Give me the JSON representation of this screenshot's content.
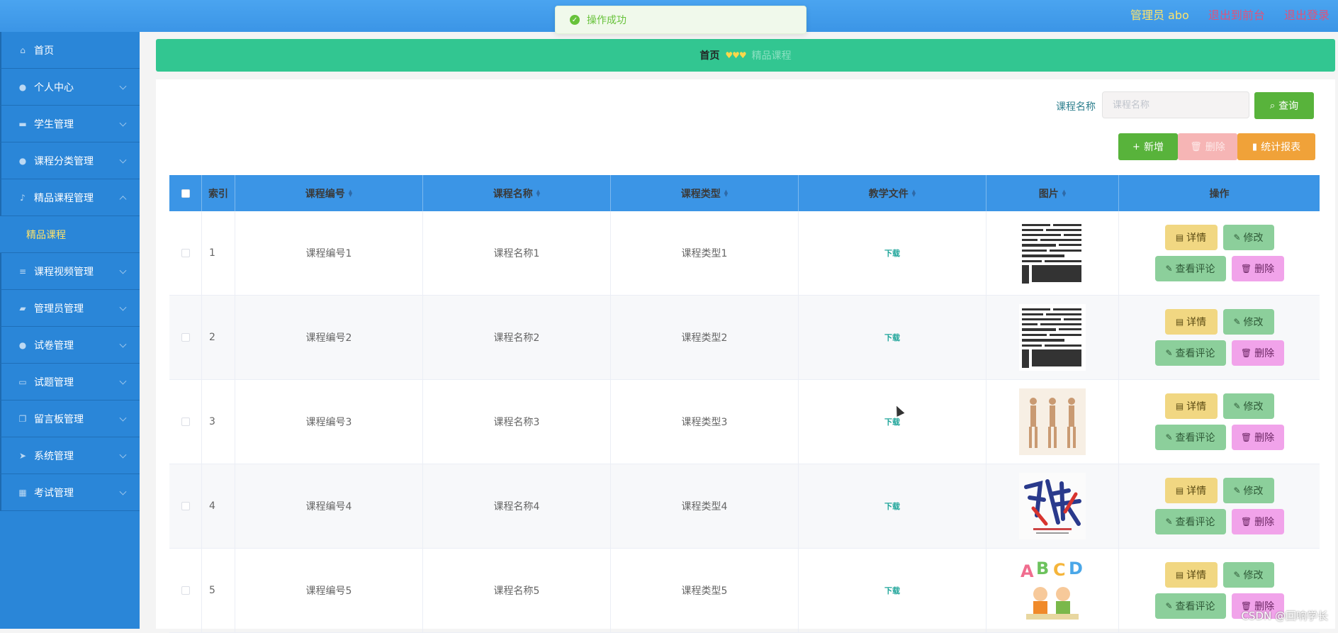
{
  "header": {
    "admin_label": "管理员 abo",
    "back_link": "退出到前台",
    "logout_link": "退出登录"
  },
  "toast": {
    "message": "操作成功"
  },
  "sidebar": {
    "items": [
      {
        "label": "首页",
        "icon": "home-icon"
      },
      {
        "label": "个人中心",
        "icon": "user-icon"
      },
      {
        "label": "学生管理",
        "icon": "monitor-icon"
      },
      {
        "label": "课程分类管理",
        "icon": "user-icon"
      },
      {
        "label": "精品课程管理",
        "icon": "mic-icon"
      },
      {
        "label": "课程视频管理",
        "icon": "sliders-icon"
      },
      {
        "label": "管理员管理",
        "icon": "ticket-icon"
      },
      {
        "label": "试卷管理",
        "icon": "user-icon"
      },
      {
        "label": "试题管理",
        "icon": "chat-icon"
      },
      {
        "label": "留言板管理",
        "icon": "copy-icon"
      },
      {
        "label": "系统管理",
        "icon": "send-icon"
      },
      {
        "label": "考试管理",
        "icon": "grid-icon"
      }
    ],
    "sub_item": "精品课程"
  },
  "breadcrumb": {
    "home": "首页",
    "current": "精品课程"
  },
  "search": {
    "label": "课程名称",
    "placeholder": "课程名称",
    "query_label": "查询"
  },
  "toolbar": {
    "add_label": "新增",
    "delete_label": "删除",
    "report_label": "统计报表"
  },
  "table": {
    "headers": [
      "索引",
      "课程编号",
      "课程名称",
      "课程类型",
      "教学文件",
      "图片",
      "操作"
    ],
    "download_label": "下载",
    "actions": {
      "detail": "详情",
      "edit": "修改",
      "comment": "查看评论",
      "remove": "删除"
    },
    "rows": [
      {
        "index": "1",
        "code": "课程编号1",
        "name": "课程名称1",
        "type": "课程类型1"
      },
      {
        "index": "2",
        "code": "课程编号2",
        "name": "课程名称2",
        "type": "课程类型2"
      },
      {
        "index": "3",
        "code": "课程编号3",
        "name": "课程名称3",
        "type": "课程类型3"
      },
      {
        "index": "4",
        "code": "课程编号4",
        "name": "课程名称4",
        "type": "课程类型4"
      },
      {
        "index": "5",
        "code": "课程编号5",
        "name": "课程名称5",
        "type": "课程类型5"
      }
    ]
  },
  "watermark": "CSDN @回响学长"
}
